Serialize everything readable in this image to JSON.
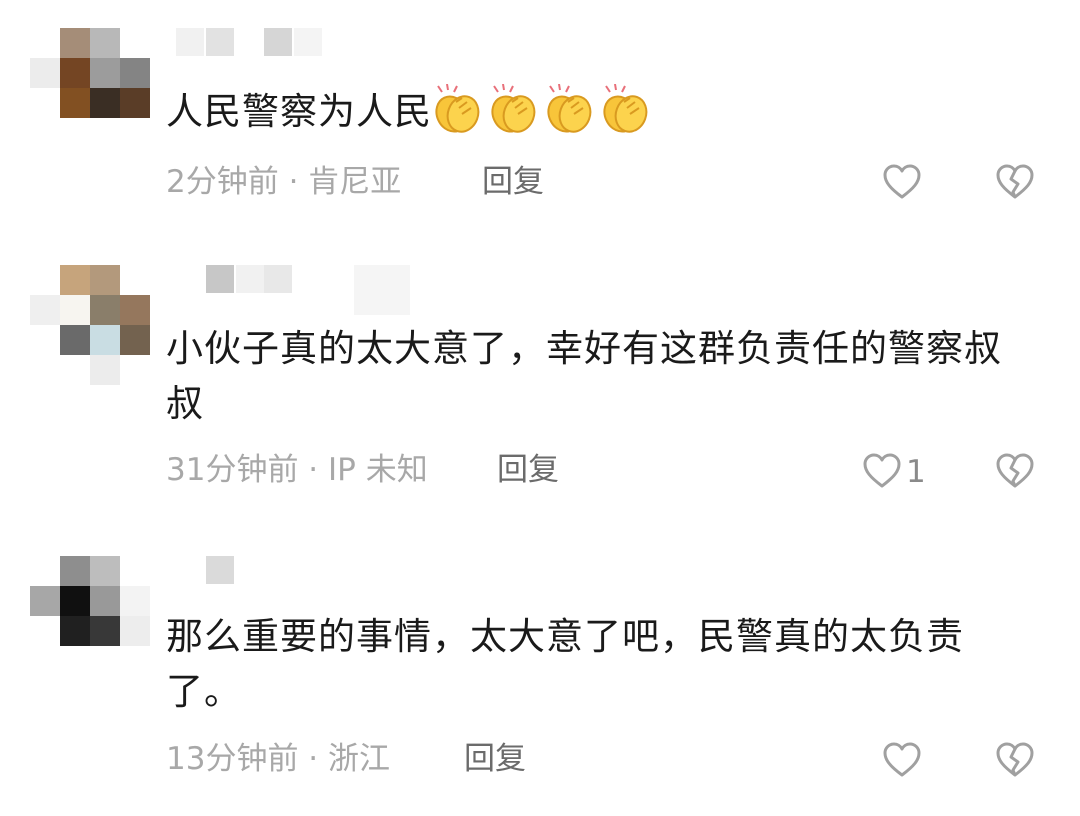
{
  "comments": [
    {
      "text": "人民警察为人民",
      "emoji": [
        "clapping-hands",
        "clapping-hands",
        "clapping-hands",
        "clapping-hands"
      ],
      "meta": "2分钟前 · 肯尼亚",
      "reply": "回复",
      "likes": ""
    },
    {
      "text": "小伙子真的太大意了，幸好有这群负责任的警察叔叔",
      "meta": "31分钟前 · IP 未知",
      "reply": "回复",
      "likes": "1"
    },
    {
      "text": "那么重要的事情，太大意了吧，民警真的太负责了。",
      "meta": "13分钟前 · 浙江",
      "reply": "回复",
      "likes": ""
    }
  ],
  "icons": {
    "like": "heart-outline-icon",
    "dislike": "broken-heart-icon",
    "emoji": "clapping-hands-icon"
  },
  "colors": {
    "text": "#1a1a1a",
    "meta": "#a8a8a8",
    "reply": "#6b6b6b",
    "icon": "#a0a0a0"
  }
}
